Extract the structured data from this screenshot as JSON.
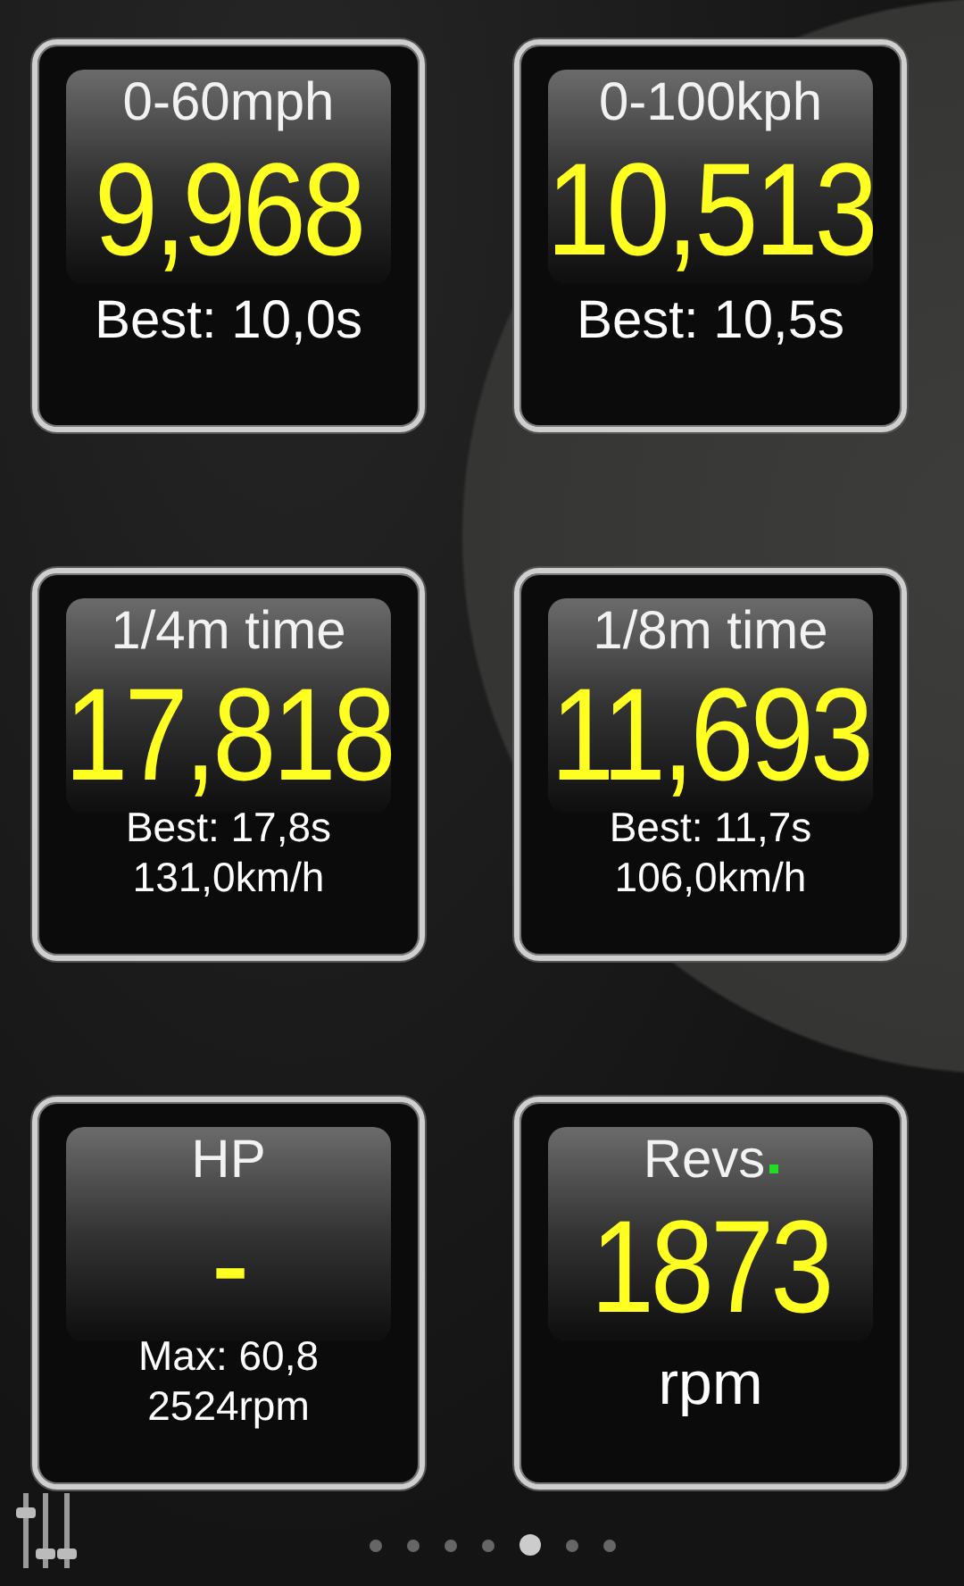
{
  "gauges": [
    {
      "title": "0-60mph",
      "value": "9,968",
      "lines": [
        "Best: 10,0s"
      ],
      "live": false,
      "kind": "timer"
    },
    {
      "title": "0-100kph",
      "value": "10,513",
      "lines": [
        "Best: 10,5s"
      ],
      "live": false,
      "kind": "timer"
    },
    {
      "title": "1/4m time",
      "value": "17,818",
      "lines": [
        "Best: 17,8s",
        "131,0km/h"
      ],
      "live": false,
      "kind": "distance"
    },
    {
      "title": "1/8m time",
      "value": "11,693",
      "lines": [
        "Best: 11,7s",
        "106,0km/h"
      ],
      "live": false,
      "kind": "distance"
    },
    {
      "title": "HP",
      "value": "-",
      "lines": [
        "Max: 60,8",
        "2524rpm"
      ],
      "live": false,
      "kind": "distance"
    },
    {
      "title": "Revs",
      "value": "1873",
      "lines": [
        "rpm"
      ],
      "live": true,
      "kind": "unit"
    }
  ],
  "pages": [
    {
      "selected": false
    },
    {
      "selected": false
    },
    {
      "selected": false
    },
    {
      "selected": false
    },
    {
      "selected": true
    },
    {
      "selected": false
    },
    {
      "selected": false
    }
  ]
}
